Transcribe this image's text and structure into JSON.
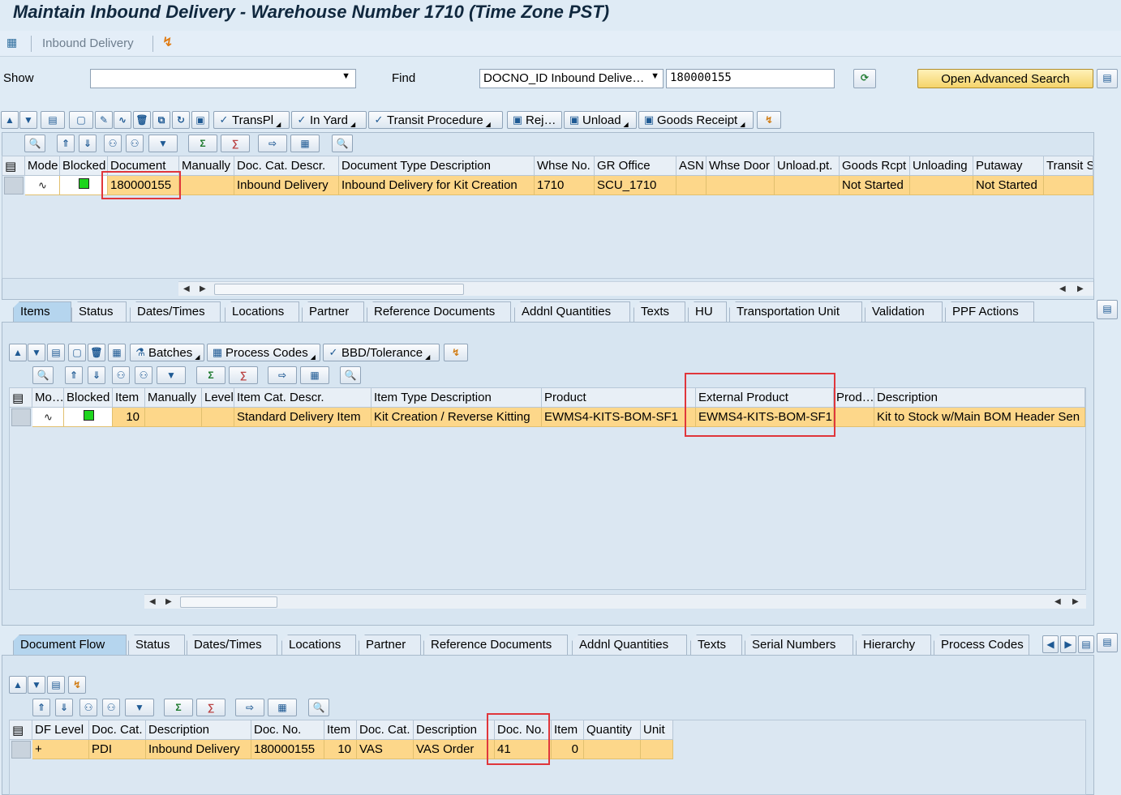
{
  "title": "Maintain Inbound Delivery - Warehouse Number 1710 (Time Zone PST)",
  "appbar": {
    "menu_label": "Inbound Delivery"
  },
  "search": {
    "show_label": "Show",
    "show_value": "",
    "find_label": "Find",
    "find_field": "DOCNO_ID Inbound Delive…",
    "find_value": "180000155",
    "advanced_label": "Open Advanced Search"
  },
  "header_toolbar": {
    "buttons": [
      "TransPl",
      "In Yard",
      "Transit Procedure",
      "Rej…",
      "Unload",
      "Goods Receipt"
    ]
  },
  "header_grid": {
    "columns": [
      "Mode",
      "Blocked",
      "Document",
      "Manually",
      "Doc. Cat. Descr.",
      "Document Type Description",
      "Whse No.",
      "GR Office",
      "ASN",
      "Whse Door",
      "Unload.pt.",
      "Goods Rcpt",
      "Unloading",
      "Putaway",
      "Transit S"
    ],
    "row": {
      "document": "180000155",
      "manually": "",
      "doc_cat": "Inbound Delivery",
      "doc_type": "Inbound Delivery for Kit Creation",
      "whse": "1710",
      "gr_office": "SCU_1710",
      "asn": "",
      "door": "",
      "unload": "",
      "goods_rcpt": "Not Started",
      "unloading": "",
      "putaway": "Not Started",
      "transit": ""
    }
  },
  "item_tabs": [
    "Items",
    "Status",
    "Dates/Times",
    "Locations",
    "Partner",
    "Reference Documents",
    "Addnl Quantities",
    "Texts",
    "HU",
    "Transportation Unit",
    "Validation",
    "PPF Actions"
  ],
  "item_toolbar": {
    "buttons": [
      "Batches",
      "Process Codes",
      "BBD/Tolerance"
    ]
  },
  "item_grid": {
    "columns": [
      "Mo…",
      "Blocked",
      "Item",
      "Manually",
      "Level",
      "Item Cat. Descr.",
      "Item Type Description",
      "Product",
      "External Product",
      "Prod…",
      "Description"
    ],
    "row": {
      "item": "10",
      "manually": "",
      "level": "",
      "item_cat": "Standard Delivery Item",
      "item_type": "Kit Creation / Reverse Kitting",
      "product": "EWMS4-KITS-BOM-SF1",
      "external_product": "EWMS4-KITS-BOM-SF1",
      "prod": "",
      "description": "Kit to Stock w/Main BOM Header Sen"
    }
  },
  "flow_tabs": [
    "Document Flow",
    "Status",
    "Dates/Times",
    "Locations",
    "Partner",
    "Reference Documents",
    "Addnl Quantities",
    "Texts",
    "Serial Numbers",
    "Hierarchy",
    "Process Codes"
  ],
  "flow_grid": {
    "columns": [
      "DF Level",
      "Doc. Cat.",
      "Description",
      "Doc. No.",
      "Item",
      "Doc. Cat.",
      "Description",
      "Doc. No.",
      "Item",
      "Quantity",
      "Unit"
    ],
    "row": [
      "+",
      "PDI",
      "Inbound Delivery",
      "180000155",
      "10",
      "VAS",
      "VAS Order",
      "41",
      "0",
      "",
      ""
    ]
  },
  "colors": {
    "row_highlight": "#fdd78a",
    "callout": "#e0363b",
    "background": "#dfebf5"
  }
}
